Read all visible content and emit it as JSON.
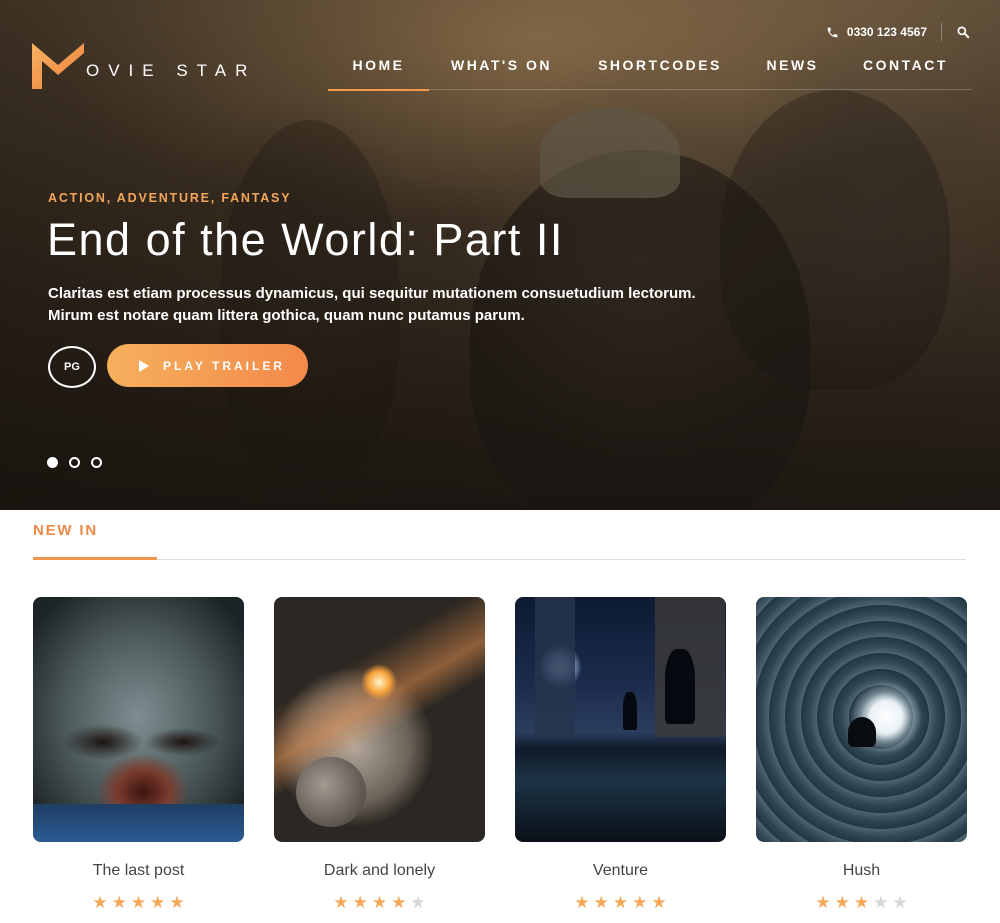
{
  "brand": {
    "logo_letter": "M",
    "name": "OVIE STAR",
    "accent": "#f39a4a"
  },
  "topbar": {
    "phone": "0330 123 4567",
    "phone_icon": "phone-icon",
    "search_icon": "search-icon"
  },
  "nav": {
    "items": [
      {
        "label": "HOME",
        "active": true
      },
      {
        "label": "WHAT'S ON",
        "active": false
      },
      {
        "label": "SHORTCODES",
        "active": false
      },
      {
        "label": "NEWS",
        "active": false
      },
      {
        "label": "CONTACT",
        "active": false
      }
    ]
  },
  "hero": {
    "genres": "ACTION, ADVENTURE, FANTASY",
    "title": "End of the World: Part II",
    "description_line1": "Claritas est etiam processus dynamicus, qui sequitur mutationem consuetudium lectorum.",
    "description_line2": "Mirum est notare quam littera gothica, quam nunc putamus parum.",
    "rating": "PG",
    "trailer_label": "PLAY TRAILER",
    "slides": 3,
    "active_slide": 1
  },
  "new_in": {
    "heading": "NEW IN",
    "movies": [
      {
        "title": "The last post",
        "stars": 5
      },
      {
        "title": "Dark and lonely",
        "stars": 4
      },
      {
        "title": "Venture",
        "stars": 5
      },
      {
        "title": "Hush",
        "stars": 3
      }
    ],
    "max_stars": 5
  }
}
